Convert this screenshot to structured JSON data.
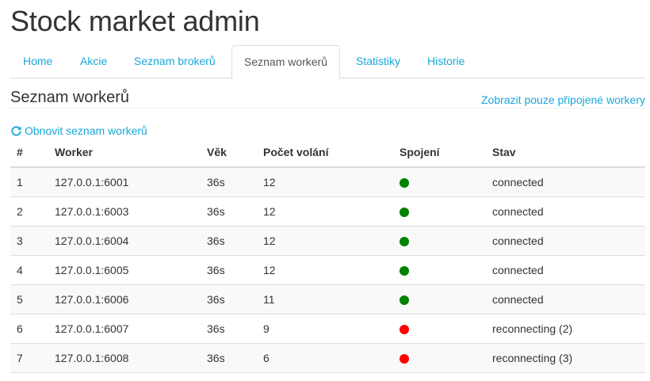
{
  "app": {
    "title": "Stock market admin"
  },
  "nav": {
    "tabs": [
      {
        "label": "Home"
      },
      {
        "label": "Akcie"
      },
      {
        "label": "Seznam brokerů"
      },
      {
        "label": "Seznam workerů",
        "active": true
      },
      {
        "label": "Statistiky"
      },
      {
        "label": "Historie"
      }
    ]
  },
  "main": {
    "title": "Seznam workerů",
    "filter_link": "Zobrazit pouze připojené workery",
    "refresh_label": "Obnovit seznam workerů",
    "refresh_icon": "refresh-icon",
    "table": {
      "columns": [
        "#",
        "Worker",
        "Věk",
        "Počet volání",
        "Spojení",
        "Stav"
      ],
      "rows": [
        {
          "num": "1",
          "worker": "127.0.0.1:6001",
          "age": "36s",
          "calls": "12",
          "connection_color": "#008000",
          "status": "connected"
        },
        {
          "num": "2",
          "worker": "127.0.0.1:6003",
          "age": "36s",
          "calls": "12",
          "connection_color": "#008000",
          "status": "connected"
        },
        {
          "num": "3",
          "worker": "127.0.0.1:6004",
          "age": "36s",
          "calls": "12",
          "connection_color": "#008000",
          "status": "connected"
        },
        {
          "num": "4",
          "worker": "127.0.0.1:6005",
          "age": "36s",
          "calls": "12",
          "connection_color": "#008000",
          "status": "connected"
        },
        {
          "num": "5",
          "worker": "127.0.0.1:6006",
          "age": "36s",
          "calls": "11",
          "connection_color": "#008000",
          "status": "connected"
        },
        {
          "num": "6",
          "worker": "127.0.0.1:6007",
          "age": "36s",
          "calls": "9",
          "connection_color": "#ff0000",
          "status": "reconnecting (2)"
        },
        {
          "num": "7",
          "worker": "127.0.0.1:6008",
          "age": "36s",
          "calls": "6",
          "connection_color": "#ff0000",
          "status": "reconnecting (3)"
        }
      ]
    }
  },
  "colors": {
    "link": "#1aa7d8",
    "connected": "#008000",
    "disconnected": "#ff0000"
  }
}
